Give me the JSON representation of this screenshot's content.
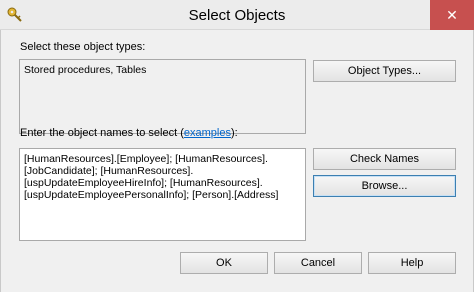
{
  "window": {
    "title": "Select Objects",
    "close_glyph": "✕",
    "icon": "key-icon"
  },
  "object_types": {
    "label": "Select these object types:",
    "value": "Stored procedures, Tables",
    "button_label": "Object Types..."
  },
  "object_names": {
    "label_prefix": "Enter the object names to select (",
    "label_link": "examples",
    "label_suffix": "):",
    "value": "[HumanResources].[Employee]; [HumanResources].\n[JobCandidate]; [HumanResources].\n[uspUpdateEmployeeHireInfo]; [HumanResources].\n[uspUpdateEmployeePersonalInfo]; [Person].[Address]",
    "check_names_label": "Check Names",
    "browse_label": "Browse..."
  },
  "footer": {
    "ok_label": "OK",
    "cancel_label": "Cancel",
    "help_label": "Help"
  },
  "colors": {
    "close_button": "#c7504f",
    "link": "#0066cc",
    "focus_border": "#3c7fb1"
  }
}
